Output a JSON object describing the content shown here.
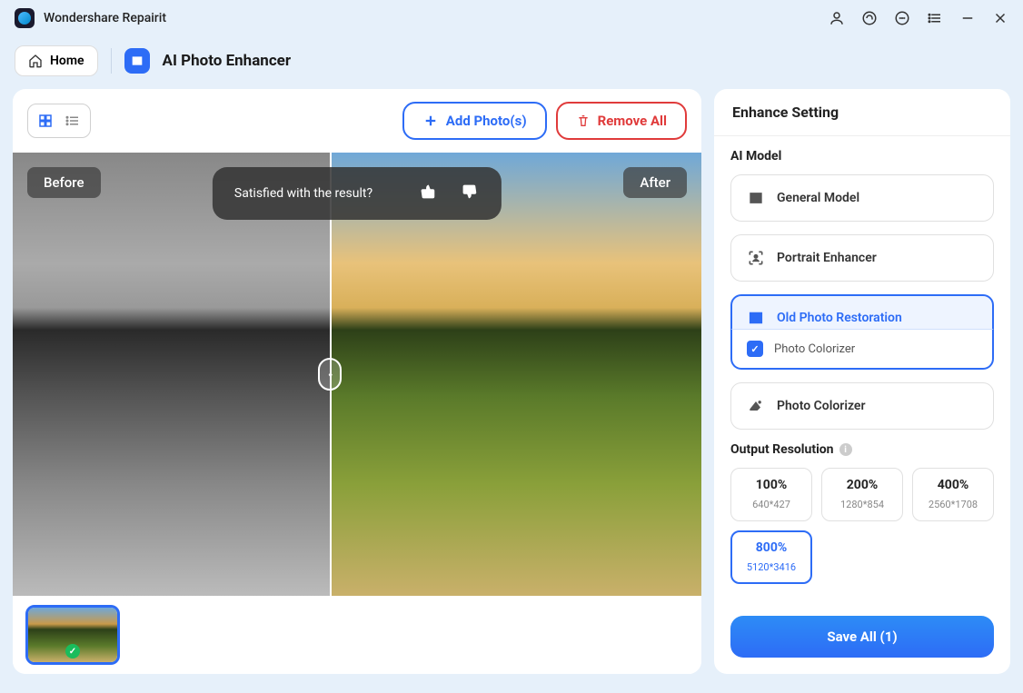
{
  "titlebar": {
    "appName": "Wondershare Repairit"
  },
  "header": {
    "home": "Home",
    "module": "AI Photo Enhancer"
  },
  "toolbar": {
    "addPhotos": "Add Photo(s)",
    "removeAll": "Remove All"
  },
  "preview": {
    "before": "Before",
    "after": "After",
    "feedback": "Satisfied with the result?"
  },
  "sidebar": {
    "title": "Enhance Setting",
    "aiModelLabel": "AI Model",
    "models": [
      {
        "name": "General Model"
      },
      {
        "name": "Portrait Enhancer"
      },
      {
        "name": "Old Photo Restoration"
      },
      {
        "name": "Photo Colorizer"
      }
    ],
    "subOption": "Photo Colorizer",
    "outputLabel": "Output Resolution",
    "resolutions": [
      {
        "pct": "100%",
        "dim": "640*427"
      },
      {
        "pct": "200%",
        "dim": "1280*854"
      },
      {
        "pct": "400%",
        "dim": "2560*1708"
      },
      {
        "pct": "800%",
        "dim": "5120*3416"
      }
    ],
    "saveAll": "Save All (1)"
  }
}
